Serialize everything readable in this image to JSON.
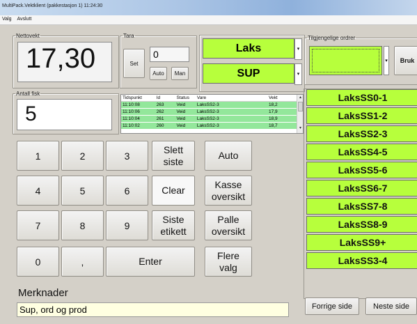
{
  "window": {
    "title": "MultiPack.Vektklient (pakkestasjon  1) 11:24:30"
  },
  "menu": {
    "items": [
      "Valg",
      "Avslutt"
    ]
  },
  "net_weight": {
    "label": "Nettovekt",
    "value": "17,30"
  },
  "tare": {
    "label": "Tara",
    "set_label": "Set",
    "value": "0",
    "auto_label": "Auto",
    "man_label": "Man"
  },
  "product": {
    "species": "Laks",
    "grade": "SUP"
  },
  "fish_count": {
    "label": "Antall fisk",
    "value": "5"
  },
  "log": {
    "columns": [
      "Tidspunkt",
      "Id",
      "Status",
      "Vare",
      "Vekt"
    ],
    "rows": [
      [
        "11:10:08",
        "263",
        "Veid",
        "LaksSS2-3",
        "18,2"
      ],
      [
        "11:10:06",
        "262",
        "Veid",
        "LaksSS2-3",
        "17,9"
      ],
      [
        "11:10:04",
        "261",
        "Veid",
        "LaksSS2-3",
        "18,9"
      ],
      [
        "11:10:02",
        "260",
        "Veid",
        "LaksSS2-3",
        "18,7"
      ]
    ]
  },
  "keypad": {
    "k1": "1",
    "k2": "2",
    "k3": "3",
    "k4": "4",
    "k5": "5",
    "k6": "6",
    "k7": "7",
    "k8": "8",
    "k9": "9",
    "k0": "0",
    "comma": ",",
    "enter": "Enter"
  },
  "actions": {
    "delete_last": "Slett\nsiste",
    "clear": "Clear",
    "last_label": "Siste\netikett",
    "auto": "Auto",
    "crate_overview": "Kasse\noversikt",
    "pallet_overview": "Palle\noversikt",
    "more_options": "Flere\nvalg"
  },
  "orders": {
    "label": "Tilgjengelige ordrer",
    "dropdown_value": "",
    "use_label": "Bruk"
  },
  "size_grades": [
    "LaksSS0-1",
    "LaksSS1-2",
    "LaksSS2-3",
    "LaksSS4-5",
    "LaksSS5-6",
    "LaksSS6-7",
    "LaksSS7-8",
    "LaksSS8-9",
    "LaksSS9+",
    "LaksSS3-4"
  ],
  "remarks": {
    "label": "Merknader",
    "value": "Sup, ord og prod"
  },
  "paging": {
    "prev": "Forrige side",
    "next": "Neste side"
  },
  "colors": {
    "accent_green": "#b7ff3c",
    "row_green": "#93e79b",
    "panel": "#d4d0c8"
  }
}
